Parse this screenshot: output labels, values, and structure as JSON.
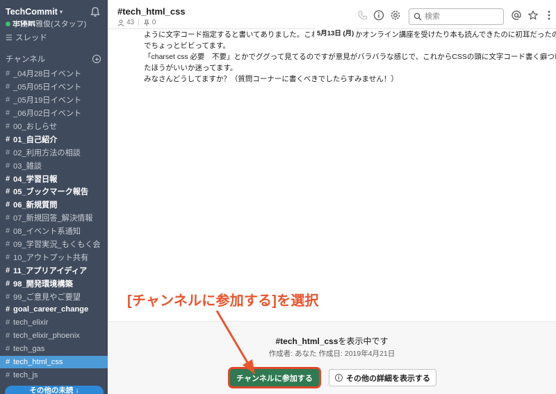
{
  "workspace": {
    "name": "TechCommit",
    "user": "小田川雅俊(スタッフ)",
    "cut_label": "全体統"
  },
  "sidebar": {
    "threads_label": "スレッド",
    "channels_label": "チャンネル",
    "channels": [
      {
        "name": "_04月28日イベント",
        "bold": false,
        "active": false
      },
      {
        "name": "_05月05日イベント",
        "bold": false,
        "active": false
      },
      {
        "name": "_05月19日イベント",
        "bold": false,
        "active": false
      },
      {
        "name": "_06月02日イベント",
        "bold": false,
        "active": false
      },
      {
        "name": "00_おしらせ",
        "bold": false,
        "active": false
      },
      {
        "name": "01_自己紹介",
        "bold": true,
        "active": false
      },
      {
        "name": "02_利用方法の相談",
        "bold": false,
        "active": false
      },
      {
        "name": "03_雑談",
        "bold": false,
        "active": false
      },
      {
        "name": "04_学習日報",
        "bold": true,
        "active": false
      },
      {
        "name": "05_ブックマーク報告",
        "bold": true,
        "active": false
      },
      {
        "name": "06_新規質問",
        "bold": true,
        "active": false
      },
      {
        "name": "07_新規回答_解決情報",
        "bold": false,
        "active": false
      },
      {
        "name": "08_イベント系通知",
        "bold": false,
        "active": false
      },
      {
        "name": "09_学習実況_もくもく会",
        "bold": false,
        "active": false
      },
      {
        "name": "10_アウトプット共有",
        "bold": false,
        "active": false
      },
      {
        "name": "11_アプリアイディア",
        "bold": true,
        "active": false
      },
      {
        "name": "98_開発環境構築",
        "bold": true,
        "active": false
      },
      {
        "name": "99_ご意見やご要望",
        "bold": false,
        "active": false
      },
      {
        "name": "goal_career_change",
        "bold": true,
        "active": false
      },
      {
        "name": "tech_elixir",
        "bold": false,
        "active": false
      },
      {
        "name": "tech_elixir_phoenix",
        "bold": false,
        "active": false
      },
      {
        "name": "tech_gas",
        "bold": false,
        "active": false
      },
      {
        "name": "tech_html_css",
        "bold": false,
        "active": true
      },
      {
        "name": "tech_js",
        "bold": false,
        "active": false
      }
    ],
    "more_unread": "その他の未読 ↓"
  },
  "header": {
    "channel_title": "#tech_html_css",
    "member_count": "43",
    "pinned_count": "0",
    "search_placeholder": "検索"
  },
  "messages": {
    "date": "5月13日 (月)",
    "lines": [
      "ように文字コード指定すると書いてありました。これまでいくつかオンライン講座を受けたり本も読んできたのに初耳だったの",
      "でちょっとビビってます。",
      "「charset css 必要　不要」とかでググって見てるのですが意見がバラバラな感じで、これからCSSの頭に文字コード書く癖つけ",
      "たほうがいいか迷ってます。",
      "みなさんどうしてますか？（質問コーナーに書くべきでしたらすみません！）"
    ]
  },
  "footer": {
    "channel_name": "#tech_html_css",
    "viewing_suffix": "を表示中です",
    "meta": "作成者: あなた 作成日: 2019年4月21日",
    "join_label": "チャンネルに参加する",
    "details_label": "その他の詳細を表示する"
  },
  "annotation": {
    "text": "[チャンネルに参加する]を選択",
    "color": "#e8552f"
  }
}
